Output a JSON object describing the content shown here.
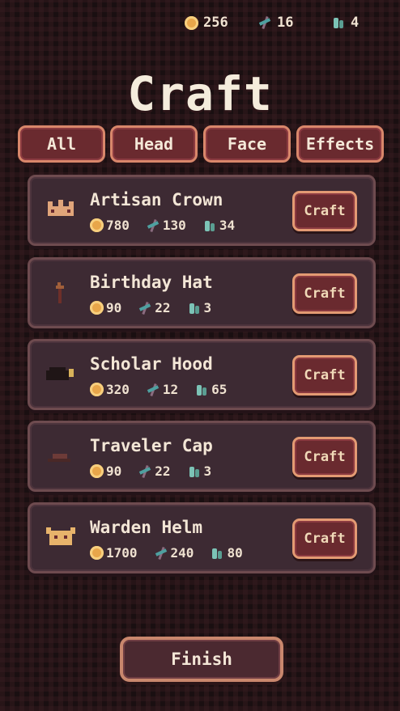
{
  "resources": {
    "coins": "256",
    "herbs": "16",
    "gems": "4",
    "icons": [
      "coin-icon",
      "herb-icon",
      "gem-icon"
    ]
  },
  "title": "Craft",
  "tabs": [
    {
      "label": "All"
    },
    {
      "label": "Head"
    },
    {
      "label": "Face"
    },
    {
      "label": "Effects"
    }
  ],
  "items": [
    {
      "name": "Artisan Crown",
      "coins": "780",
      "herbs": "130",
      "gems": "34",
      "button": "Craft",
      "icon": "crown-icon",
      "color": "#e0a57a"
    },
    {
      "name": "Birthday Hat",
      "coins": "90",
      "herbs": "22",
      "gems": "3",
      "button": "Craft",
      "icon": "party-hat-icon",
      "color": "#a15f3a"
    },
    {
      "name": "Scholar Hood",
      "coins": "320",
      "herbs": "12",
      "gems": "65",
      "button": "Craft",
      "icon": "hood-icon",
      "color": "#1f1516"
    },
    {
      "name": "Traveler Cap",
      "coins": "90",
      "herbs": "22",
      "gems": "3",
      "button": "Craft",
      "icon": "cap-icon",
      "color": "#6d3b38"
    },
    {
      "name": "Warden Helm",
      "coins": "1700",
      "herbs": "240",
      "gems": "80",
      "button": "Craft",
      "icon": "helm-icon",
      "color": "#e7b36b"
    }
  ],
  "footer": {
    "finish_label": "Finish"
  }
}
